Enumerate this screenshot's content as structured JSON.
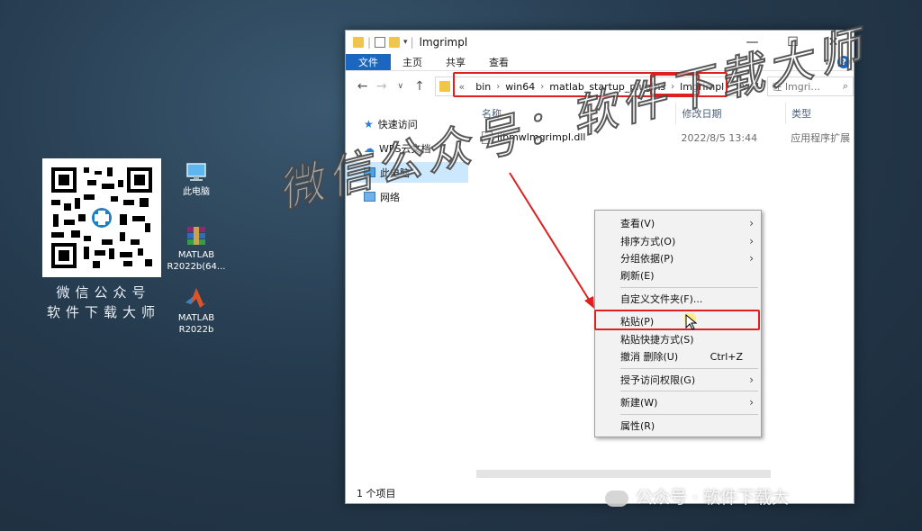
{
  "desktop": {
    "caption_line1": "微信公众号",
    "caption_line2": "软件下载大师",
    "icons": [
      {
        "label": "此电脑"
      },
      {
        "label": "MATLAB R2022b(64..."
      },
      {
        "label": "MATLAB R2022b"
      }
    ]
  },
  "window": {
    "title": "lmgrimpl",
    "controls": {
      "minimize": "—",
      "maximize": "☐",
      "close": "✕"
    },
    "ribbon": {
      "tabs": [
        "文件",
        "主页",
        "共享",
        "查看"
      ]
    },
    "address": {
      "overflow": "«",
      "crumbs": [
        "bin",
        "win64",
        "matlab_startup_plugins",
        "lmgrimpl"
      ],
      "dropdown": "∨",
      "refresh": "↻"
    },
    "search": {
      "placeholder": "在 lmgri..."
    },
    "sidebar": {
      "items": [
        "快速访问",
        "WPS云文档",
        "此电脑",
        "网络"
      ]
    },
    "columns": {
      "name": "名称",
      "date": "修改日期",
      "type": "类型"
    },
    "files": [
      {
        "name": "libmwlmgrimpl.dll",
        "date": "2022/8/5 13:44",
        "type": "应用程序扩展"
      }
    ],
    "status": "1 个项目"
  },
  "context_menu": {
    "items": [
      {
        "label": "查看(V)",
        "submenu": true
      },
      {
        "label": "排序方式(O)",
        "submenu": true
      },
      {
        "label": "分组依据(P)",
        "submenu": true
      },
      {
        "label": "刷新(E)"
      },
      {
        "label": "自定义文件夹(F)..."
      },
      {
        "label": "粘贴(P)"
      },
      {
        "label": "粘贴快捷方式(S)"
      },
      {
        "label": "撤消 删除(U)",
        "shortcut": "Ctrl+Z"
      },
      {
        "label": "授予访问权限(G)",
        "submenu": true
      },
      {
        "label": "新建(W)",
        "submenu": true
      },
      {
        "label": "属性(R)"
      }
    ]
  },
  "watermark": {
    "main": "微信公众号：软件下载大师",
    "bottom": "公众号 · 软件下载大"
  },
  "colors": {
    "highlight": "#e02020",
    "ribbon_file": "#1b67c0",
    "selection": "#cce8ff"
  }
}
